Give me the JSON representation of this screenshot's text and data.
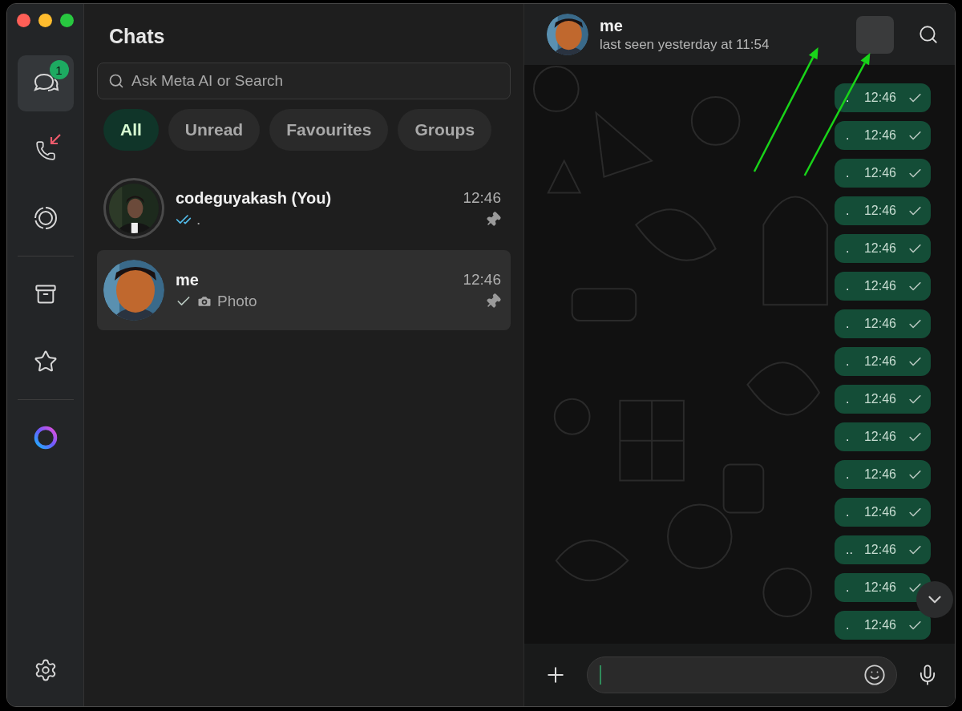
{
  "window": {
    "title": "Chats"
  },
  "sidebar": {
    "groups": [
      [
        {
          "kind": "chats",
          "selected": true,
          "badge": "1"
        },
        {
          "kind": "calls",
          "selected": false,
          "missed": true
        },
        {
          "kind": "status",
          "selected": false
        }
      ],
      [
        {
          "kind": "archive",
          "selected": false
        },
        {
          "kind": "starred",
          "selected": false
        }
      ],
      [
        {
          "kind": "meta_ai",
          "selected": false
        }
      ]
    ],
    "bottom": [
      {
        "kind": "settings",
        "selected": false
      }
    ]
  },
  "search": {
    "placeholder": "Ask Meta AI or Search"
  },
  "filters": [
    {
      "label": "All",
      "selected": true
    },
    {
      "label": "Unread",
      "selected": false
    },
    {
      "label": "Favourites",
      "selected": false
    },
    {
      "label": "Groups",
      "selected": false
    }
  ],
  "chats": [
    {
      "name": "codeguyakash (You)",
      "time": "12:46",
      "preview": ".",
      "photo": false,
      "read": true,
      "pinned": true,
      "status_ring": true,
      "selected": false
    },
    {
      "name": "me",
      "time": "12:46",
      "preview": "Photo",
      "photo": true,
      "read": false,
      "pinned": true,
      "status_ring": false,
      "selected": true
    }
  ],
  "conversation": {
    "name": "me",
    "subtitle": "last seen yesterday at 11:54",
    "messages": [
      {
        "text": ".",
        "time": "12:46",
        "read": false
      },
      {
        "text": ".",
        "time": "12:46",
        "read": false
      },
      {
        "text": ".",
        "time": "12:46",
        "read": false
      },
      {
        "text": ".",
        "time": "12:46",
        "read": false
      },
      {
        "text": ".",
        "time": "12:46",
        "read": false
      },
      {
        "text": ".",
        "time": "12:46",
        "read": false
      },
      {
        "text": ".",
        "time": "12:46",
        "read": false
      },
      {
        "text": ".",
        "time": "12:46",
        "read": false
      },
      {
        "text": ".",
        "time": "12:46",
        "read": false
      },
      {
        "text": ".",
        "time": "12:46",
        "read": false
      },
      {
        "text": ".",
        "time": "12:46",
        "read": false
      },
      {
        "text": ".",
        "time": "12:46",
        "read": false
      },
      {
        "text": "..",
        "time": "12:46",
        "read": false
      },
      {
        "text": ".",
        "time": "12:46",
        "read": false
      },
      {
        "text": ".",
        "time": "12:46",
        "read": false
      }
    ]
  },
  "annotations": [
    {
      "kind": "arrow"
    },
    {
      "kind": "arrow"
    }
  ]
}
